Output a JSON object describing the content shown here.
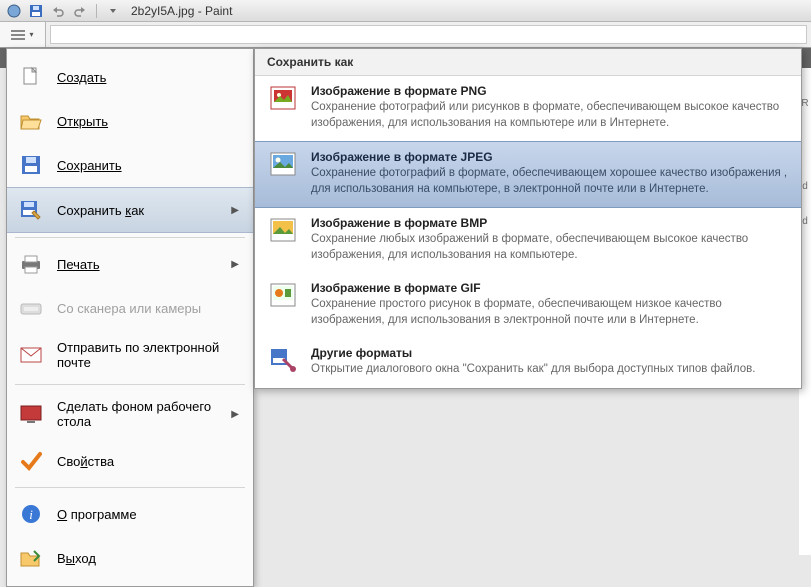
{
  "window": {
    "title": "2b2yI5A.jpg - Paint"
  },
  "appmenu": {
    "create": "Создать",
    "open": "Открыть",
    "save": "Сохранить",
    "save_as": "Сохранить как",
    "print": "Печать",
    "scanner": "Со сканера или камеры",
    "send": "Отправить по электронной почте",
    "set_bg": "Сделать фоном рабочего стола",
    "properties": "Свойства",
    "about": "О программе",
    "exit": "Выход"
  },
  "submenu": {
    "header": "Сохранить как",
    "png": {
      "title": "Изображение в формате PNG",
      "desc": "Сохранение фотографий или рисунков в формате, обеспечивающем высокое качество изображения, для использования на компьютере или в Интернете."
    },
    "jpeg": {
      "title": "Изображение в формате JPEG",
      "desc": "Сохранение фотографий в формате, обеспечивающем хорошее качество изображения , для использования на компьютере, в электронной почте или в Интернете."
    },
    "bmp": {
      "title": "Изображение в формате BMP",
      "desc": "Сохранение любых изображений в формате, обеспечивающем высокое качество изображения, для использования на компьютере."
    },
    "gif": {
      "title": "Изображение в формате GIF",
      "desc": "Сохранение простого рисунок в формате, обеспечивающем низкое качество изображения, для использования в электронной почте или в Интернете."
    },
    "other": {
      "title": "Другие форматы",
      "desc": "Открытие диалогового окна \"Сохранить как\" для выбора доступных типов файлов."
    }
  },
  "context_tag": "ig"
}
